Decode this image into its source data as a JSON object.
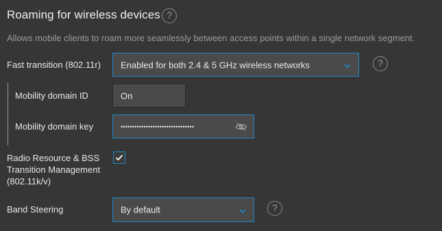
{
  "section": {
    "title": "Roaming for wireless devices",
    "description": "Allows mobile clients to roam more seamlessly between access points within a single network segment."
  },
  "help_glyph": "?",
  "fast_transition": {
    "label": "Fast transition (802.11r)",
    "value": "Enabled for both 2.4 & 5 GHz wireless networks"
  },
  "mobility_domain_id": {
    "label": "Mobility domain ID",
    "value": "On"
  },
  "mobility_domain_key": {
    "label": "Mobility domain key",
    "value": "••••••••••••••••••••••••••••••••"
  },
  "rrm": {
    "label_line1": "Radio Resource & BSS",
    "label_line2": "Transition Management",
    "label_line3": "(802.11k/v)",
    "checked": true
  },
  "band_steering": {
    "label": "Band Steering",
    "value": "By default"
  },
  "icons": {
    "help": "help-circle-icon",
    "dropdown": "chevron-down-icon",
    "visibility": "eye-off-icon",
    "check": "checkmark-icon"
  },
  "colors": {
    "background": "#363636",
    "accent": "#1e88c8",
    "field_bg": "#4a4a4a"
  }
}
